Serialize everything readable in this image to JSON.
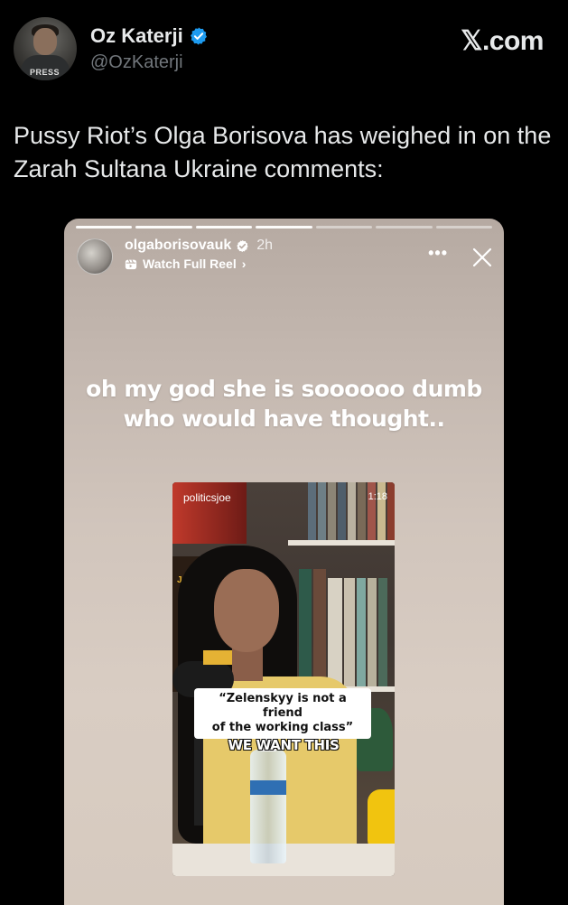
{
  "tweet": {
    "display_name": "Oz Katerji",
    "handle": "@OzKaterji",
    "site": "𝕏.com",
    "avatar_badge": "PRESS",
    "text_line1": "Pussy Riot’s Olga Borisova has weighed in on the",
    "text_line2": "Zarah Sultana Ukraine comments:",
    "verified_color": "#1d9bf0"
  },
  "story": {
    "username": "olgaborisovauk",
    "time": "2h",
    "reel_link": "Watch Full Reel",
    "reel_chevron": "›",
    "more_icon": "more-dots-icon",
    "close_icon": "close-icon",
    "caption_line1": "oh my god she is soooooo dumb",
    "caption_line2": "who would have thought.."
  },
  "video": {
    "handle": "politicsjoe",
    "duration": "1:18",
    "brand": "JOE",
    "quote_line1": "“Zelenskyy is not a friend",
    "quote_line2": "of the working class”",
    "overlay": "WE WANT THIS"
  }
}
